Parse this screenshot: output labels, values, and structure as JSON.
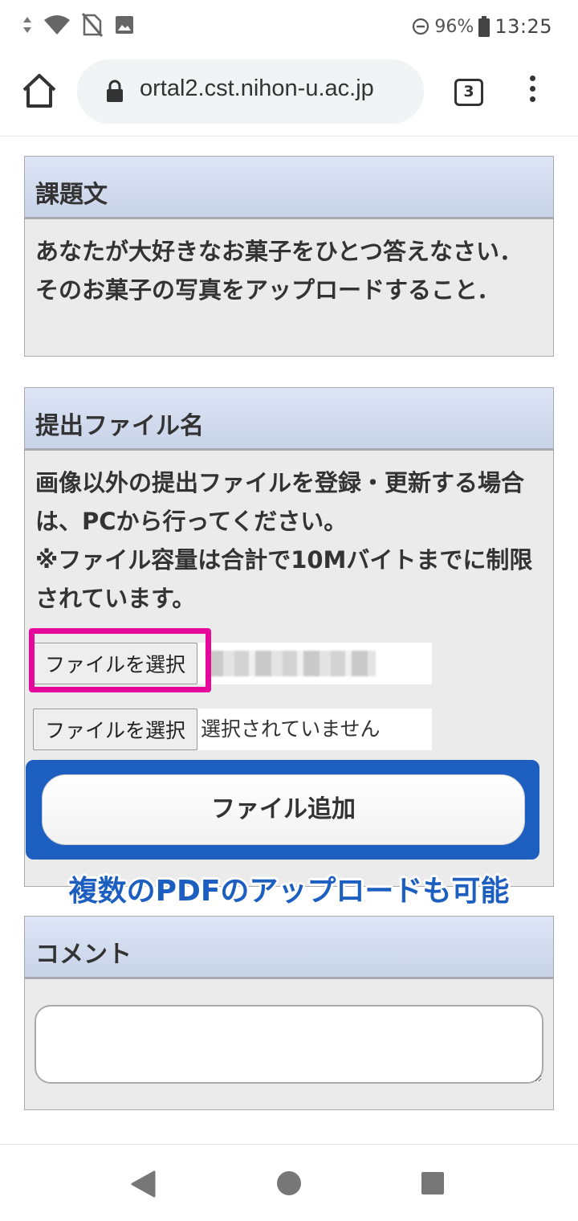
{
  "status_bar": {
    "battery": "96%",
    "time": "13:25"
  },
  "browser": {
    "url": "ortal2.cst.nihon-u.ac.jp",
    "tab_count": "3"
  },
  "assignment": {
    "header": "課題文",
    "body": "あなたが大好きなお菓子をひとつ答えなさい．そのお菓子の写真をアップロードすること．"
  },
  "submission": {
    "header": "提出ファイル名",
    "note_line1": "画像以外の提出ファイルを登録・更新する場合は、PCから行ってください。",
    "note_line2": "※ファイル容量は合計で10Mバイトまでに制限されています。",
    "file_button_1": "ファイルを選択",
    "file_button_2": "ファイルを選択",
    "file_status_2": "選択されていません",
    "add_file_button": "ファイル追加"
  },
  "annotation": "複数のPDFのアップロードも可能",
  "comment": {
    "header": "コメント",
    "value": ""
  },
  "colors": {
    "highlight_magenta": "#e6089b",
    "highlight_blue": "#1d5fc0"
  }
}
